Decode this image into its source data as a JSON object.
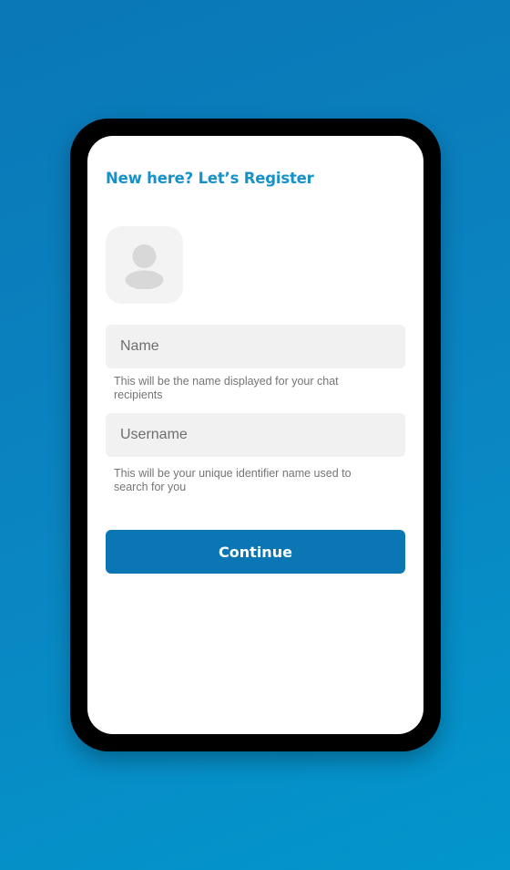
{
  "register": {
    "title": "New here? Let’s Register",
    "avatar_icon": "user-placeholder-icon",
    "name_field": {
      "placeholder": "Name",
      "value": "",
      "helper": "This will be the name displayed for your chat recipients"
    },
    "username_field": {
      "placeholder": "Username",
      "value": "",
      "helper": "This will be your unique identifier name used to search for you"
    },
    "continue_label": "Continue"
  },
  "colors": {
    "background_start": "#0a77b6",
    "background_end": "#0296cc",
    "accent": "#1592c9",
    "button": "#0a76b4",
    "field_bg": "#f1f1f1",
    "helper_text": "#757575"
  }
}
